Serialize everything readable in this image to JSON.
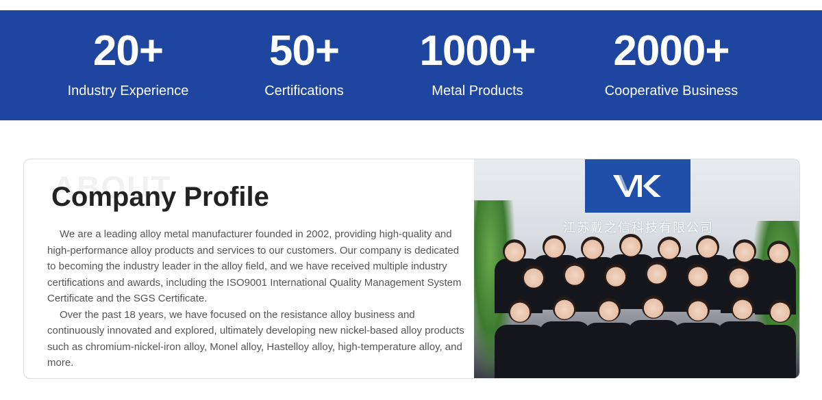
{
  "stats": [
    {
      "value": "20+",
      "label": "Industry Experience"
    },
    {
      "value": "50+",
      "label": "Certifications"
    },
    {
      "value": "1000+",
      "label": "Metal Products"
    },
    {
      "value": "2000+",
      "label": "Cooperative Business"
    }
  ],
  "profile": {
    "watermark": "ABOUT",
    "title": "Company Profile",
    "paragraphs": [
      "We are a leading alloy metal manufacturer founded in 2002, providing high-quality and high-performance alloy products and services to our customers. Our company is dedicated to becoming the industry leader in the alloy field, and we have received multiple industry certifications and awards, including the ISO9001 International Quality Management System Certificate and the SGS Certificate.",
      "Over the past 18 years, we have focused on the resistance alloy business and continuously innovated and explored, ultimately developing new nickel-based alloy products such as chromium-nickel-iron alloy, Monel alloy, Hastelloy alloy, high-temperature alloy, and more."
    ]
  },
  "photo": {
    "company_sign": "江苏戴之信科技有限公司",
    "colors": {
      "sign_blue": "#1f4fa8",
      "band_blue": "#1e46a0"
    }
  }
}
